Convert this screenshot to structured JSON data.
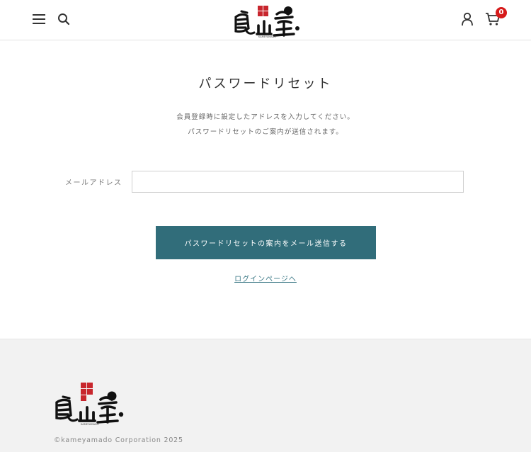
{
  "header": {
    "menu_icon": "hamburger-menu-icon",
    "search_icon": "search-icon",
    "account_icon": "user-account-icon",
    "cart_icon": "shopping-cart-icon",
    "cart_count": "0",
    "logo_alt": "亀山堂"
  },
  "main": {
    "title": "パスワードリセット",
    "description_line1": "会員登録時に設定したアドレスを入力してください。",
    "description_line2": "パスワードリセットのご案内が送信されます。",
    "email_label": "メールアドレス",
    "email_value": "",
    "submit_label": "パスワードリセットの案内をメール送信する",
    "login_link": "ログインページへ"
  },
  "footer": {
    "copyright": "©kameyamado Corporation 2025"
  },
  "colors": {
    "accent": "#316d7a",
    "badge": "#d61a1a",
    "logo_red": "#c8262d",
    "footer_bg": "#f2f2f2"
  }
}
